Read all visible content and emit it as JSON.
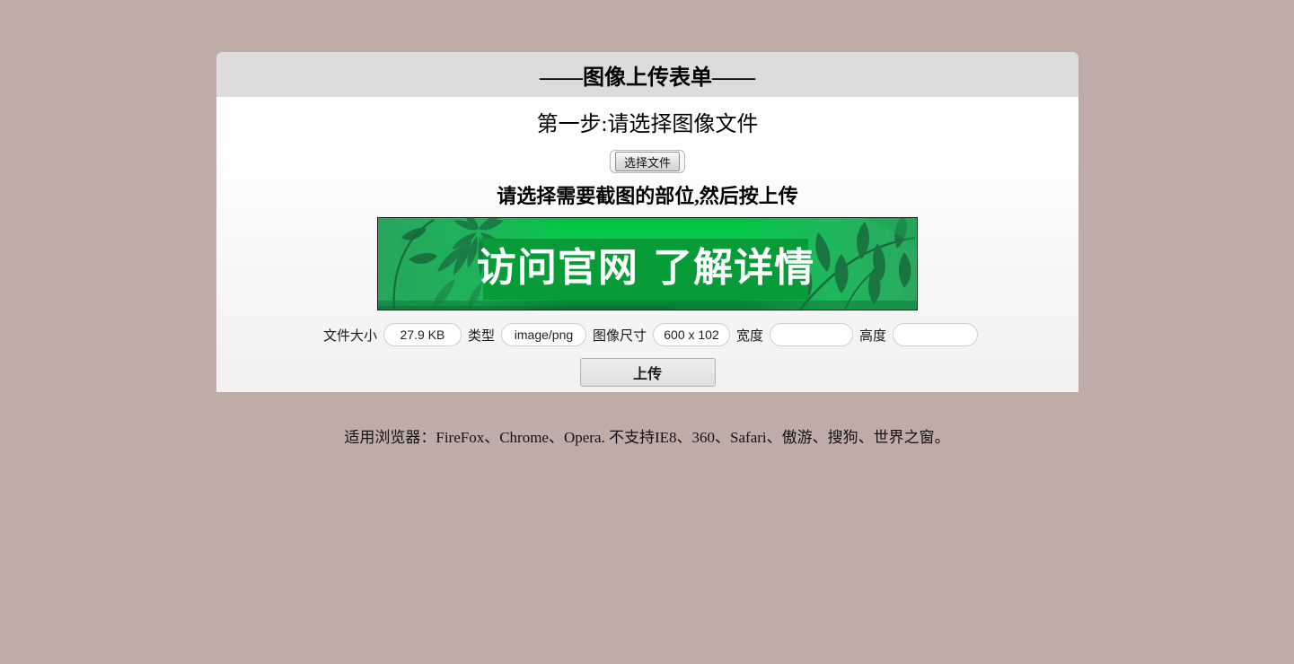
{
  "page": {
    "background_color": "#c0aca7",
    "panel_background": "#ffffff",
    "header_background": "#dcdcdc"
  },
  "panel": {
    "title": "——图像上传表单——",
    "step_heading": "第一步:请选择图像文件",
    "file_input": {
      "button_label": "选择文件",
      "file_name": ""
    },
    "crop_heading": "请选择需要截图的部位,然后按上传"
  },
  "preview": {
    "alt": "banner-preview",
    "banner_text": "访问官网 了解详情",
    "colors": {
      "bright_green": "#00c23f",
      "mid_green": "#15c458",
      "dark_green": "#089c38",
      "leaf_green": "#1b7a45",
      "border": "#1b1b1b",
      "text": "#ffffff"
    }
  },
  "meta": {
    "fields": [
      {
        "label": "文件大小",
        "value": "27.9 KB",
        "placeholder": "",
        "name": "file-size",
        "class": "size"
      },
      {
        "label": "类型",
        "value": "image/png",
        "placeholder": "",
        "name": "file-type",
        "class": "type"
      },
      {
        "label": "图像尺寸",
        "value": "600 x 102",
        "placeholder": "",
        "name": "image-dimensions",
        "class": "dim"
      },
      {
        "label": "宽度",
        "value": "",
        "placeholder": "",
        "name": "crop-width",
        "class": "wide"
      },
      {
        "label": "高度",
        "value": "",
        "placeholder": "",
        "name": "crop-height",
        "class": "high"
      }
    ]
  },
  "actions": {
    "upload_label": "上传"
  },
  "footer": {
    "note": "适用浏览器：FireFox、Chrome、Opera. 不支持IE8、360、Safari、傲游、搜狗、世界之窗。"
  }
}
